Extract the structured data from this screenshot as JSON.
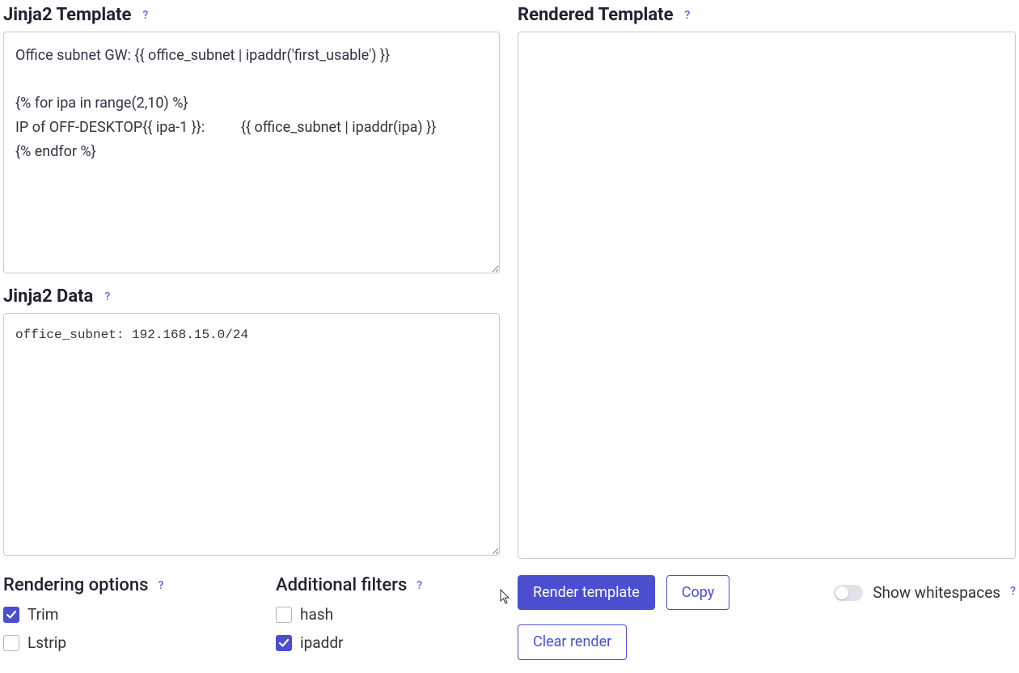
{
  "left": {
    "template": {
      "title": "Jinja2 Template",
      "help": "?",
      "value": "Office subnet GW: {{ office_subnet | ipaddr('first_usable') }}\n\n{% for ipa in range(2,10) %}\nIP of OFF-DESKTOP{{ ipa-1 }}:          {{ office_subnet | ipaddr(ipa) }}\n{% endfor %}"
    },
    "data": {
      "title": "Jinja2 Data",
      "help": "?",
      "value": "office_subnet: 192.168.15.0/24"
    },
    "rendering_options": {
      "title": "Rendering options",
      "help": "?",
      "items": [
        {
          "label": "Trim",
          "checked": true
        },
        {
          "label": "Lstrip",
          "checked": false
        }
      ]
    },
    "additional_filters": {
      "title": "Additional filters",
      "help": "?",
      "items": [
        {
          "label": "hash",
          "checked": false
        },
        {
          "label": "ipaddr",
          "checked": true
        }
      ]
    }
  },
  "right": {
    "rendered": {
      "title": "Rendered Template",
      "help": "?",
      "value": ""
    },
    "buttons": {
      "render": "Render template",
      "copy": "Copy",
      "clear": "Clear render"
    },
    "toggle": {
      "label": "Show whitespaces",
      "help": "?",
      "on": false
    }
  }
}
